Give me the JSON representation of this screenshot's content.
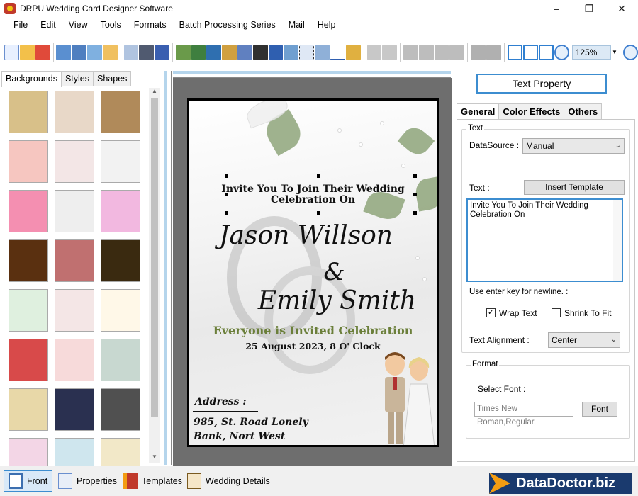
{
  "app": {
    "title": "DRPU Wedding Card Designer Software"
  },
  "window_controls": {
    "minimize": "–",
    "maximize": "❐",
    "close": "✕"
  },
  "menu": [
    "File",
    "Edit",
    "View",
    "Tools",
    "Formats",
    "Batch Processing Series",
    "Mail",
    "Help"
  ],
  "toolbar": {
    "zoom_value": "125%"
  },
  "left_panel": {
    "tabs": [
      "Backgrounds",
      "Styles",
      "Shapes"
    ],
    "active_tab": "Backgrounds",
    "thumbnail_colors": [
      [
        "#d8c089",
        "#e8d8c8",
        "#b08a5a"
      ],
      [
        "#f6c6c0",
        "#f3e6e6",
        "#f2f2f2"
      ],
      [
        "#f48fb1",
        "#eeeeee",
        "#f2b8e0"
      ],
      [
        "#5a3010",
        "#c07070",
        "#3a2a10"
      ],
      [
        "#dff0df",
        "#f4e6e6",
        "#fff8e8"
      ],
      [
        "#d84a4a",
        "#f7dada",
        "#c8d8d0"
      ],
      [
        "#e8d8a8",
        "#2a3050",
        "#505050"
      ],
      [
        "#f3d6e6",
        "#cfe6ee",
        "#f2e8c8"
      ]
    ]
  },
  "card": {
    "invite_line1": "Invite You To Join Their Wedding",
    "invite_line2": "Celebration On",
    "name1": "Jason Willson",
    "ampersand": "&",
    "name2": "Emily Smith",
    "everyone": "Everyone is Invited Celebration",
    "date": "25 August 2023, 8 O' Clock",
    "address_label": "Address :",
    "address_line1": "985, St. Road Lonely",
    "address_line2": "Bank, Nort West"
  },
  "right_panel": {
    "title": "Text Property",
    "tabs": [
      "General",
      "Color Effects",
      "Others"
    ],
    "active_tab": "General",
    "text_group_label": "Text",
    "datasource_label": "DataSource :",
    "datasource_value": "Manual",
    "text_label": "Text :",
    "insert_template_button": "Insert Template",
    "textarea_line1": "Invite You To Join Their Wedding",
    "textarea_line2": "Celebration On",
    "newline_hint": "Use enter key for newline. :",
    "wrap_text_label": "Wrap Text",
    "wrap_text_checked": true,
    "shrink_to_fit_label": "Shrink To Fit",
    "shrink_to_fit_checked": false,
    "alignment_label": "Text Alignment :",
    "alignment_value": "Center",
    "format_group_label": "Format",
    "select_font_label": "Select Font :",
    "font_value": "Times New Roman,Regular,",
    "font_button": "Font"
  },
  "bottom_bar": {
    "items": [
      "Front",
      "Properties",
      "Templates",
      "Wedding Details"
    ],
    "active": "Front",
    "brand": "DataDoctor.biz"
  },
  "colors": {
    "accent_blue": "#3c8dd0",
    "ruler_band": "#b5d5ec",
    "olive_text": "#6b7f3a",
    "brand_bg": "#1a3a6e"
  }
}
